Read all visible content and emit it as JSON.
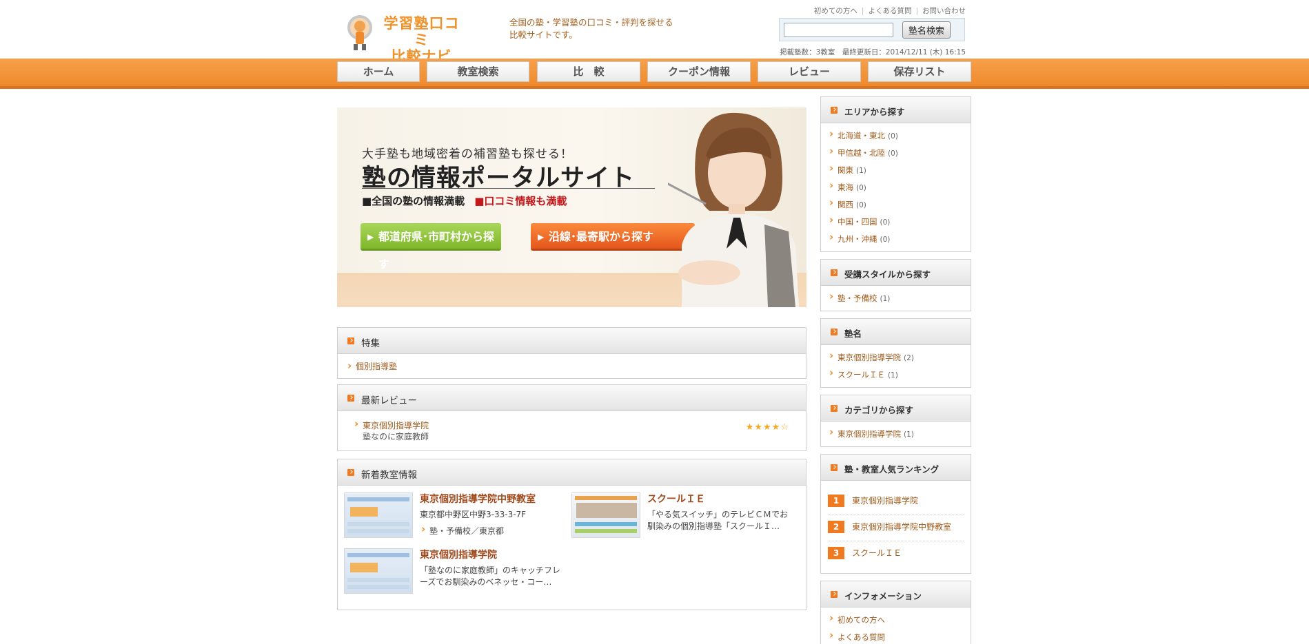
{
  "header": {
    "logo_line1": "学習塾口コミ",
    "logo_line2": "比較ナビ",
    "tagline_line1": "全国の塾・学習塾の口コミ・評判を探せる",
    "tagline_line2": "比較サイトです。",
    "toplinks": [
      "初めての方へ",
      "よくある質問",
      "お問い合わせ"
    ],
    "search": {
      "value": "",
      "button_label": "塾名検索"
    },
    "meta": "掲載塾数：3教室　最終更新日：2014/12/11 (木) 16:15"
  },
  "nav": [
    "ホーム",
    "教室検索",
    "比　較",
    "クーポン情報",
    "レビュー",
    "保存リスト"
  ],
  "hero": {
    "line1": "大手塾も地域密着の補習塾も探せる！",
    "line2": "塾の情報ポータルサイト",
    "line3a": "■全国の塾の情報満載",
    "line3b": "■口コミ情報も満載",
    "button_area": "都道府県･市町村から探す",
    "button_station": "沿線･最寄駅から探す"
  },
  "tokushu": {
    "title": "特集",
    "items": [
      "個別指導塾"
    ]
  },
  "reviews": {
    "title": "最新レビュー",
    "items": [
      {
        "school": "東京個別指導学院",
        "comment": "塾なのに家庭教師",
        "stars": "★★★★☆",
        "rating": 4
      }
    ]
  },
  "new_classrooms": {
    "title": "新着教室情報",
    "items": [
      {
        "name": "東京個別指導学院中野教室",
        "address": "東京都中野区中野3-33-3-7F",
        "category": "塾・予備校／東京都"
      },
      {
        "name": "スクールＩＥ",
        "desc": "「やる気スイッチ」のテレビＣＭでお馴染みの個別指導塾「スクールＩ…"
      },
      {
        "name": "東京個別指導学院",
        "desc": "「塾なのに家庭教師」のキャッチフレーズでお馴染みのベネッセ・コー…"
      }
    ]
  },
  "sidebar": {
    "area": {
      "title": "エリアから探す",
      "items": [
        {
          "label": "北海道・東北",
          "count": "(0)"
        },
        {
          "label": "甲信越・北陸",
          "count": "(0)"
        },
        {
          "label": "関東",
          "count": "(1)"
        },
        {
          "label": "東海",
          "count": "(0)"
        },
        {
          "label": "関西",
          "count": "(0)"
        },
        {
          "label": "中国・四国",
          "count": "(0)"
        },
        {
          "label": "九州・沖縄",
          "count": "(0)"
        }
      ]
    },
    "style": {
      "title": "受講スタイルから探す",
      "items": [
        {
          "label": "塾・予備校",
          "count": "(1)"
        }
      ]
    },
    "names": {
      "title": "塾名",
      "items": [
        {
          "label": "東京個別指導学院",
          "count": "(2)"
        },
        {
          "label": "スクールＩＥ",
          "count": "(1)"
        }
      ]
    },
    "category": {
      "title": "カテゴリから探す",
      "items": [
        {
          "label": "東京個別指導学院",
          "count": "(1)"
        }
      ]
    },
    "ranking": {
      "title": "塾・教室人気ランキング",
      "items": [
        {
          "num": "1",
          "label": "東京個別指導学院"
        },
        {
          "num": "2",
          "label": "東京個別指導学院中野教室"
        },
        {
          "num": "3",
          "label": "スクールＩＥ"
        }
      ]
    },
    "info": {
      "title": "インフォメーション",
      "items": [
        "初めての方へ",
        "よくある質問"
      ]
    }
  },
  "colors": {
    "accent": "#ef8a2c",
    "link": "#a05a1a",
    "hero_green": "#8cc33a",
    "hero_orange": "#ee6a24"
  }
}
